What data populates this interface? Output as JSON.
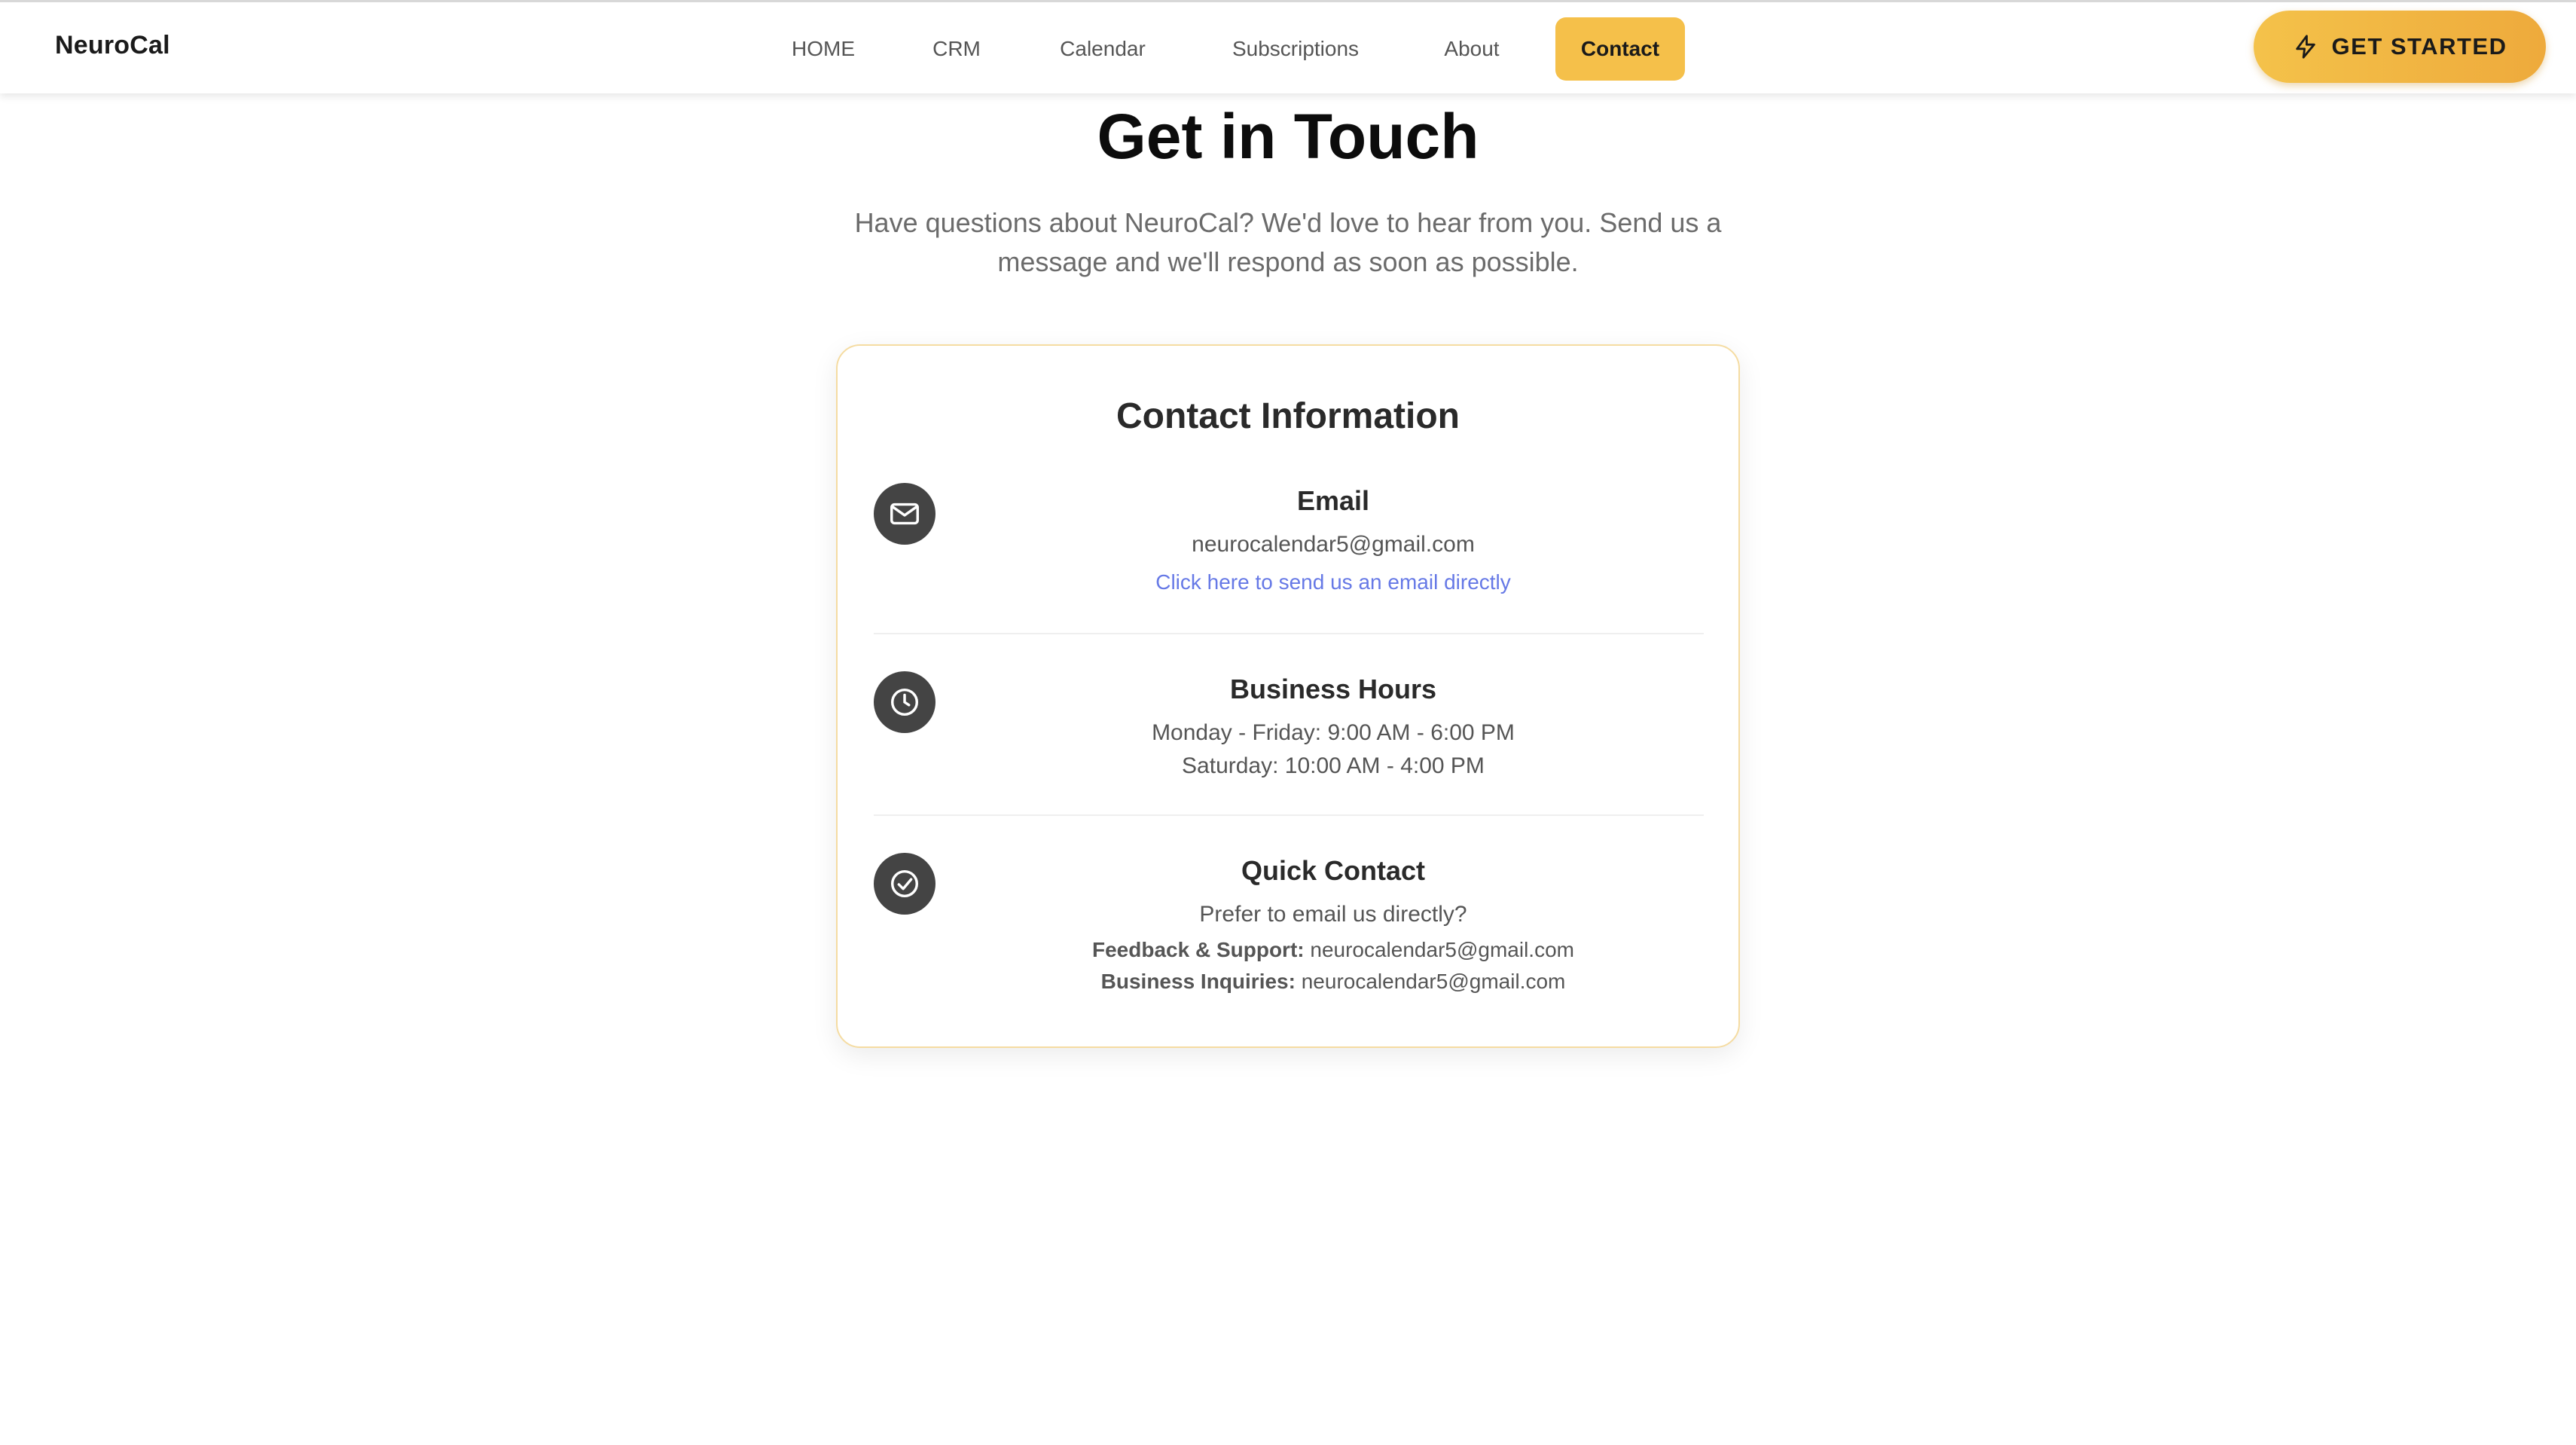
{
  "header": {
    "brand": "NeuroCal",
    "nav": [
      {
        "label": "HOME",
        "active": false
      },
      {
        "label": "CRM",
        "active": false
      },
      {
        "label": "Calendar",
        "active": false
      },
      {
        "label": "Subscriptions",
        "active": false
      },
      {
        "label": "About",
        "active": false
      },
      {
        "label": "Contact",
        "active": true
      }
    ],
    "cta_label": "GET STARTED",
    "cta_icon": "lightning-bolt-icon"
  },
  "hero": {
    "title": "Get in Touch",
    "subtitle": "Have questions about NeuroCal? We'd love to hear from you. Send us a message and we'll respond as soon as possible."
  },
  "card": {
    "title": "Contact Information",
    "email": {
      "icon": "mail-icon",
      "title": "Email",
      "address": "neurocalendar5@gmail.com",
      "link_text": "Click here to send us an email directly"
    },
    "hours": {
      "icon": "clock-icon",
      "title": "Business Hours",
      "weekday": "Monday - Friday: 9:00 AM - 6:00 PM",
      "saturday": "Saturday: 10:00 AM - 4:00 PM"
    },
    "quick": {
      "icon": "check-circle-icon",
      "title": "Quick Contact",
      "prompt": "Prefer to email us directly?",
      "feedback_label": "Feedback & Support:",
      "feedback_email": "neurocalendar5@gmail.com",
      "business_label": "Business Inquiries:",
      "business_email": "neurocalendar5@gmail.com"
    }
  },
  "colors": {
    "accent": "#f5c04a",
    "accent_gradient_end": "#eeaa3c",
    "link": "#6679e6",
    "icon_bg": "#444444",
    "card_border": "#f5dca2"
  }
}
